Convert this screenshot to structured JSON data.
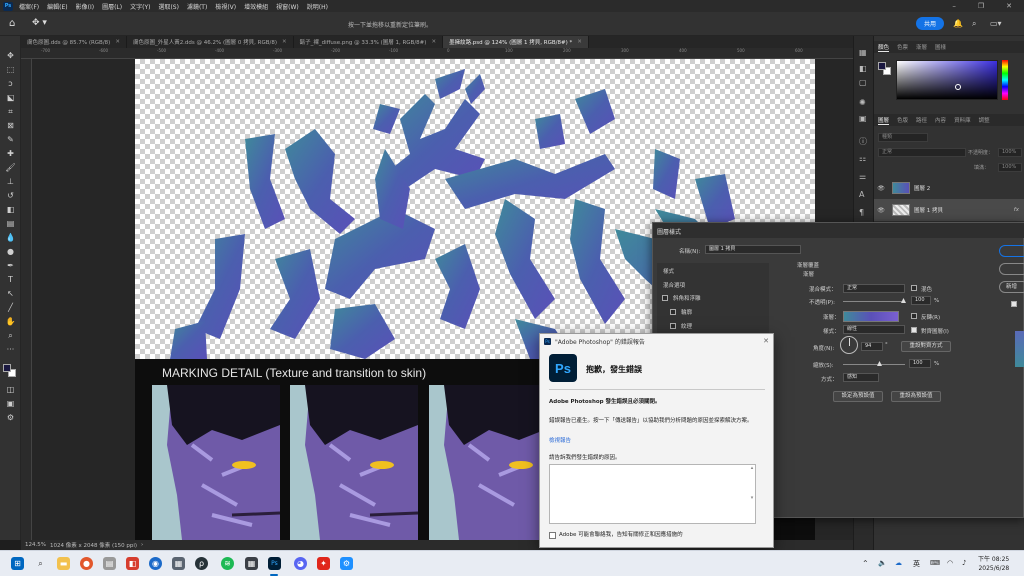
{
  "menubar": {
    "app_logo": "Ps",
    "items": [
      "檔案(F)",
      "編輯(E)",
      "影像(I)",
      "圖層(L)",
      "文字(Y)",
      "選取(S)",
      "濾鏡(T)",
      "檢視(V)",
      "增效模組",
      "視窗(W)",
      "說明(H)"
    ],
    "window_controls": [
      "–",
      "❐",
      "✕"
    ]
  },
  "optionsbar": {
    "hint": "按一下並拖移以重新定位筆刷。",
    "share_label": "共用"
  },
  "tabs": [
    {
      "label": "膚色原圖.dds @ 85.7% (RGB/8)",
      "active": false
    },
    {
      "label": "膚色原圖_外星人黃2.dds @ 46.2% (圖層 0 拷貝, RGB/8)",
      "active": false
    },
    {
      "label": "鬍子_裸_diffuse.png @ 33.3% (圖層 1, RGB/8#)",
      "active": false
    },
    {
      "label": "墨擁紋路.psd @ 124% (圖層 1 拷貝, RGB/8#) *",
      "active": true
    }
  ],
  "ruler_top": [
    "-700",
    "-600",
    "-500",
    "-400",
    "-300",
    "-200",
    "-100",
    "0",
    "100",
    "200",
    "300",
    "400",
    "500",
    "600"
  ],
  "reference": {
    "title": "MARKING DETAIL (Texture and transition to skin)"
  },
  "statusbar": {
    "zoom": "124.5%",
    "doc_info": "1024 像素 x 2048 像素 (150 ppi)"
  },
  "panels": {
    "color_tabs": [
      "顏色",
      "色票",
      "漸層",
      "圖樣"
    ],
    "layers_tabs": [
      "圖層",
      "色版",
      "路徑",
      "內容",
      "資料庫",
      "調整"
    ],
    "kind_placeholder": "種類",
    "blend_mode": "正常",
    "opacity_label": "不透明度：",
    "opacity_value": "100%",
    "fill_label": "填滿：",
    "fill_value": "100%",
    "layers": [
      {
        "name": "圖層 2",
        "selected": false
      },
      {
        "name": "圖層 1 拷貝",
        "selected": true
      }
    ],
    "fx_label": "fx"
  },
  "layer_style": {
    "title": "圖層樣式",
    "name_label": "名稱(N):",
    "name_value": "圖層 1 拷貝",
    "styles_header": "樣式",
    "blend_options": "混合選項",
    "bevel": "斜角和浮雕",
    "contour": "輪廓",
    "texture": "紋理",
    "section_title": "漸層覆蓋",
    "subsection": "漸層",
    "blend_mode_label": "混合模式：",
    "blend_mode_value": "正常",
    "dither_label": "混色",
    "opacity_label": "不透明(P):",
    "opacity_value": "100",
    "pct": "%",
    "gradient_label": "漸層：",
    "reverse_label": "反轉(R)",
    "style_label": "樣式：",
    "style_value": "線性",
    "align_label": "對齊圖層(I)",
    "angle_label": "角度(N):",
    "angle_value": "94",
    "degree": "°",
    "reset_align": "重設對齊方式",
    "scale_label": "縮放(S):",
    "scale_value": "100",
    "method_label": "方式：",
    "method_value": "感知",
    "make_default": "設定為預設值",
    "reset_default": "重設為預設值",
    "new_style": "新增"
  },
  "error_dialog": {
    "window_title": "\"Adobe Photoshop\" 的錯誤報告",
    "heading": "抱歉，發生錯誤",
    "bold_line": "Adobe Photoshop 發生錯誤且必須關閉。",
    "body": "錯誤報告已產生。按一下「傳送報告」以協助我們分析問題的原因並探索解決方案。",
    "view_report": "檢視報告",
    "describe": "請告訴我們發生錯誤的原因。",
    "contact": "Adobe 可能會聯絡我，告知有關修正和因應措施的"
  },
  "taskbar": {
    "time": "下午 08:25",
    "date": "2025/6/28",
    "ime": "英"
  },
  "colors": {
    "accent": "#1473e6",
    "marking_purple": "#5a50b8",
    "marking_teal": "#3f8a9a",
    "ps_blue": "#31a8ff"
  }
}
